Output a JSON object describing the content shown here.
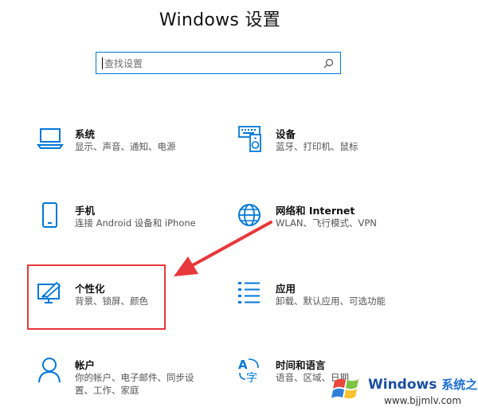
{
  "window": {
    "title": "Windows 设置"
  },
  "search": {
    "placeholder": "查找设置"
  },
  "tiles": [
    {
      "name": "系统",
      "desc": [
        "显示、声音、通知、电源"
      ],
      "icon": "laptop-icon"
    },
    {
      "name": "设备",
      "desc": [
        "蓝牙、打印机、鼠标"
      ],
      "icon": "keyboard-speaker-icon"
    },
    {
      "name": "手机",
      "desc": [
        "连接 Android 设备和 iPhone"
      ],
      "icon": "phone-icon"
    },
    {
      "name": "网络和 Internet",
      "desc": [
        "WLAN、飞行模式、VPN"
      ],
      "icon": "globe-icon"
    },
    {
      "name": "个性化",
      "desc": [
        "背景、锁屏、颜色"
      ],
      "icon": "paint-brush-icon"
    },
    {
      "name": "应用",
      "desc": [
        "卸载、默认应用、可选功能"
      ],
      "icon": "apps-list-icon"
    },
    {
      "name": "帐户",
      "desc": [
        "你的帐户、电子邮件、同步设",
        "置、工作、家庭"
      ],
      "icon": "person-icon"
    },
    {
      "name": "时间和语言",
      "desc": [
        "语音、区域、日期"
      ],
      "icon": "time-language-icon"
    }
  ],
  "colors": {
    "accent": "#0078d7",
    "highlight": "#e8373a"
  },
  "watermark": {
    "brand": "Windows",
    "brand_sub": "系统之家",
    "url": "www.bjjmlv.com"
  }
}
